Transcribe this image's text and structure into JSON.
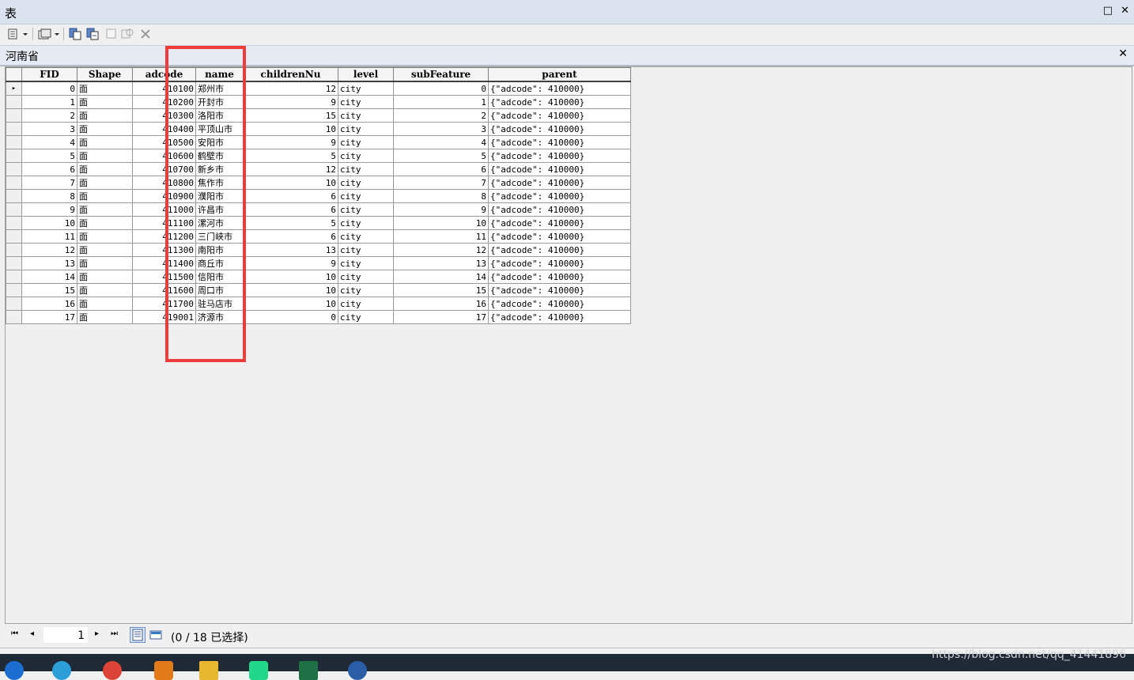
{
  "window": {
    "title": "表",
    "maximize_glyph": "□",
    "close_glyph": "✕"
  },
  "toolbar": {
    "items": [
      {
        "icon": "table-options-icon"
      },
      {
        "icon": "related-tables-icon"
      },
      {
        "icon": "select-by-attributes-icon"
      },
      {
        "icon": "switch-selection-icon"
      },
      {
        "icon": "clear-selection-icon"
      },
      {
        "icon": "zoom-to-selected-icon"
      },
      {
        "icon": "delete-selected-icon"
      }
    ]
  },
  "tab": {
    "name": "河南省",
    "close_glyph": "✕"
  },
  "table": {
    "columns": [
      "FID",
      "Shape",
      "adcode",
      "name",
      "childrenNu",
      "level",
      "subFeature",
      "parent"
    ],
    "rows": [
      [
        "0",
        "面",
        "410100",
        "郑州市",
        "12",
        "city",
        "0",
        "{\"adcode\": 410000}"
      ],
      [
        "1",
        "面",
        "410200",
        "开封市",
        "9",
        "city",
        "1",
        "{\"adcode\": 410000}"
      ],
      [
        "2",
        "面",
        "410300",
        "洛阳市",
        "15",
        "city",
        "2",
        "{\"adcode\": 410000}"
      ],
      [
        "3",
        "面",
        "410400",
        "平顶山市",
        "10",
        "city",
        "3",
        "{\"adcode\": 410000}"
      ],
      [
        "4",
        "面",
        "410500",
        "安阳市",
        "9",
        "city",
        "4",
        "{\"adcode\": 410000}"
      ],
      [
        "5",
        "面",
        "410600",
        "鹤壁市",
        "5",
        "city",
        "5",
        "{\"adcode\": 410000}"
      ],
      [
        "6",
        "面",
        "410700",
        "新乡市",
        "12",
        "city",
        "6",
        "{\"adcode\": 410000}"
      ],
      [
        "7",
        "面",
        "410800",
        "焦作市",
        "10",
        "city",
        "7",
        "{\"adcode\": 410000}"
      ],
      [
        "8",
        "面",
        "410900",
        "濮阳市",
        "6",
        "city",
        "8",
        "{\"adcode\": 410000}"
      ],
      [
        "9",
        "面",
        "411000",
        "许昌市",
        "6",
        "city",
        "9",
        "{\"adcode\": 410000}"
      ],
      [
        "10",
        "面",
        "411100",
        "漯河市",
        "5",
        "city",
        "10",
        "{\"adcode\": 410000}"
      ],
      [
        "11",
        "面",
        "411200",
        "三门峡市",
        "6",
        "city",
        "11",
        "{\"adcode\": 410000}"
      ],
      [
        "12",
        "面",
        "411300",
        "南阳市",
        "13",
        "city",
        "12",
        "{\"adcode\": 410000}"
      ],
      [
        "13",
        "面",
        "411400",
        "商丘市",
        "9",
        "city",
        "13",
        "{\"adcode\": 410000}"
      ],
      [
        "14",
        "面",
        "411500",
        "信阳市",
        "10",
        "city",
        "14",
        "{\"adcode\": 410000}"
      ],
      [
        "15",
        "面",
        "411600",
        "周口市",
        "10",
        "city",
        "15",
        "{\"adcode\": 410000}"
      ],
      [
        "16",
        "面",
        "411700",
        "驻马店市",
        "10",
        "city",
        "16",
        "{\"adcode\": 410000}"
      ],
      [
        "17",
        "面",
        "419001",
        "济源市",
        "0",
        "city",
        "17",
        "{\"adcode\": 410000}"
      ]
    ]
  },
  "nav": {
    "first_glyph": "⏮",
    "prev_glyph": "◂",
    "next_glyph": "▸",
    "last_glyph": "⏭",
    "current_record": "1",
    "status": "(0 / 18 已选择)"
  },
  "watermark": "https://blog.csdn.net/qq_41441896",
  "colors": {
    "highlight_box": "#ee3c3c",
    "titlebar": "#dbe3ef",
    "taskbar": "#202a36"
  }
}
